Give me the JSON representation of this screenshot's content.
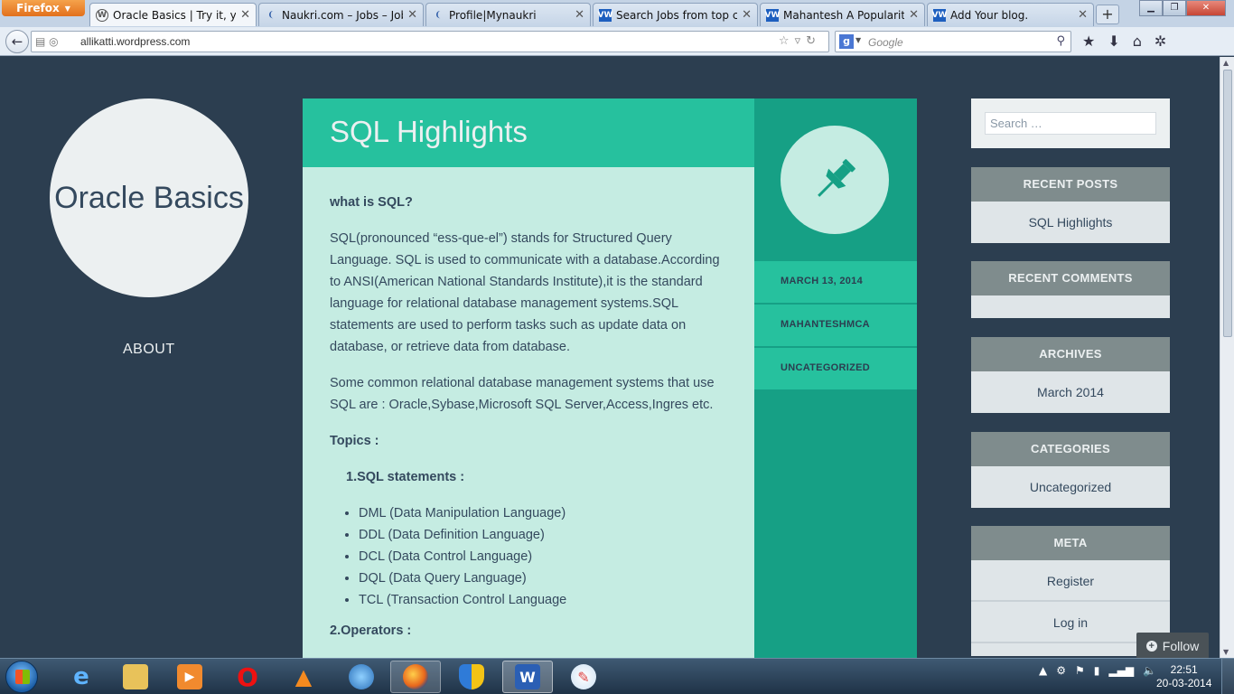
{
  "browser": {
    "app_button": "Firefox",
    "tabs": [
      {
        "title": "Oracle Basics | Try it, you...",
        "icon": "wordpress-icon",
        "active": true
      },
      {
        "title": "Naukri.com – Jobs – Jobs...",
        "icon": "naukri-icon",
        "active": false
      },
      {
        "title": "Profile|Mynaukri",
        "icon": "naukri-icon",
        "active": false
      },
      {
        "title": "Search Jobs from top co...",
        "icon": "vw-icon",
        "active": false
      },
      {
        "title": "Mahantesh A Popularity ...",
        "icon": "vw-icon",
        "active": false
      },
      {
        "title": "Add Your blog.",
        "icon": "vw-icon",
        "active": false
      }
    ],
    "url": "allikatti.wordpress.com",
    "search_engine": "Google",
    "search_placeholder": "Google"
  },
  "site": {
    "title": "Oracle Basics",
    "nav": [
      "ABOUT"
    ]
  },
  "post": {
    "title": "SQL Highlights",
    "q1": "what is SQL?",
    "p1": "SQL(pronounced “ess-que-el”) stands for Structured Query Language. SQL is used to communicate with a database.According to ANSI(American National Standards Institute),it is the standard language for relational database management systems.SQL statements are used to perform tasks such as update data on database, or retrieve data from database.",
    "p2": "Some common relational database management systems that use SQL are : Oracle,Sybase,Microsoft SQL Server,Access,Ingres etc.",
    "topics_heading": "Topics :",
    "sub_heading": "1.SQL statements :",
    "list": [
      "DML (Data Manipulation Language)",
      "DDL (Data Definition Language)",
      "DCL (Data Control Language)",
      "DQL (Data Query Language)",
      "TCL (Transaction Control Language"
    ],
    "next_heading_partial": "2.Operators :",
    "date": "MARCH 13, 2014",
    "author": "MAHANTESHMCA",
    "category": "UNCATEGORIZED"
  },
  "sidebar": {
    "search_placeholder": "Search …",
    "recent_posts_title": "RECENT POSTS",
    "recent_posts": [
      "SQL Highlights"
    ],
    "recent_comments_title": "RECENT COMMENTS",
    "archives_title": "ARCHIVES",
    "archives": [
      "March 2014"
    ],
    "categories_title": "CATEGORIES",
    "categories": [
      "Uncategorized"
    ],
    "meta_title": "META",
    "meta": [
      "Register",
      "Log in"
    ]
  },
  "follow_label": "Follow",
  "taskbar": {
    "time": "22:51",
    "date": "20-03-2014"
  }
}
